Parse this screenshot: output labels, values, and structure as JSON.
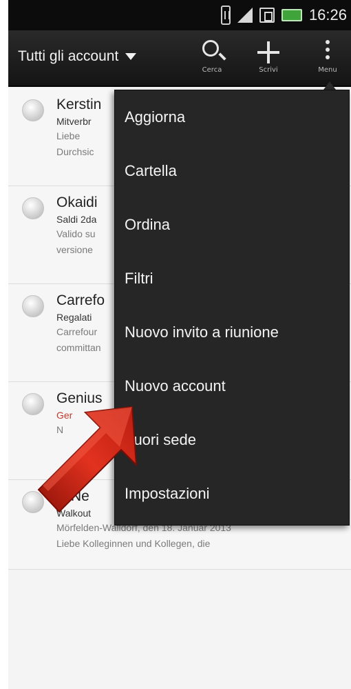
{
  "status_bar": {
    "time": "16:26"
  },
  "action_bar": {
    "account_selector": "Tutti gli account",
    "actions": [
      {
        "label": "Cerca",
        "icon": "search-icon"
      },
      {
        "label": "Scrivi",
        "icon": "plus-icon"
      },
      {
        "label": "Menu",
        "icon": "overflow-menu-icon"
      }
    ]
  },
  "mail_list": [
    {
      "sender": "Kerstin",
      "subject": "Mitverbr",
      "preview": [
        "Liebe",
        "Durchsic"
      ]
    },
    {
      "sender": "Okaidi",
      "subject": "Saldi 2da",
      "preview": [
        "Valido su",
        "versione"
      ]
    },
    {
      "sender": "Carrefo",
      "subject": "Regalati",
      "preview": [
        "Carrefour",
        "committan"
      ]
    },
    {
      "sender": "Genius",
      "subject": "Ger",
      "preview": [
        "N",
        ""
      ]
    },
    {
      "sender": "D Ne",
      "subject": "Walkout",
      "preview": [
        "Mörfelden-Walldorf, den 18. Januar 2013",
        "Liebe Kolleginnen und Kollegen, die"
      ]
    }
  ],
  "menu": {
    "items": [
      "Aggiorna",
      "Cartella",
      "Ordina",
      "Filtri",
      "Nuovo invito a riunione",
      "Nuovo account",
      "Fuori sede",
      "Impostazioni"
    ]
  },
  "colors": {
    "action_bar": "#1c1c1c",
    "menu_background": "#262626",
    "highlight_arrow": "#d42b1e",
    "battery": "#3fa43a"
  }
}
